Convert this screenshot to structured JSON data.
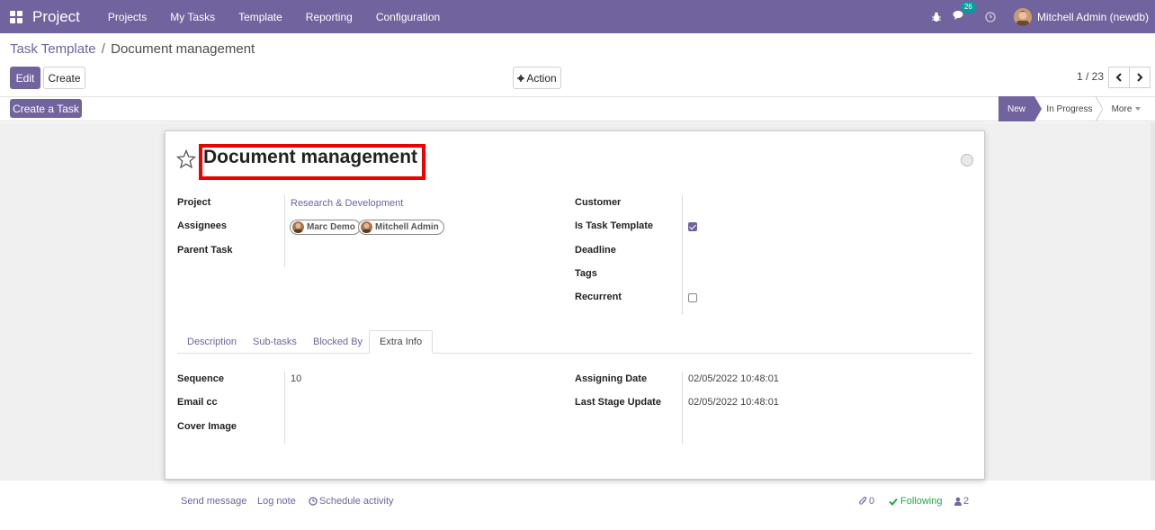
{
  "navbar": {
    "brand": "Project",
    "menu": [
      "Projects",
      "My Tasks",
      "Template",
      "Reporting",
      "Configuration"
    ],
    "chat_count": "26",
    "user_name": "Mitchell Admin (newdb)"
  },
  "breadcrumb": {
    "parent": "Task Template",
    "separator": "/",
    "current": "Document management"
  },
  "buttons": {
    "edit": "Edit",
    "create": "Create",
    "action": "Action",
    "create_task": "Create a Task"
  },
  "pager": {
    "value": "1 / 23"
  },
  "stages": {
    "new": "New",
    "in_progress": "In Progress",
    "more": "More"
  },
  "form": {
    "title": "Document management",
    "left": {
      "project_label": "Project",
      "project_value": "Research & Development",
      "assignees_label": "Assignees",
      "assignees": [
        "Marc Demo",
        "Mitchell Admin"
      ],
      "parent_task_label": "Parent Task"
    },
    "right": {
      "customer_label": "Customer",
      "is_template_label": "Is Task Template",
      "is_template": true,
      "deadline_label": "Deadline",
      "tags_label": "Tags",
      "recurrent_label": "Recurrent",
      "recurrent": false
    },
    "tabs": [
      "Description",
      "Sub-tasks",
      "Blocked By",
      "Extra Info"
    ],
    "active_tab": "Extra Info",
    "extra": {
      "sequence_label": "Sequence",
      "sequence_value": "10",
      "email_cc_label": "Email cc",
      "cover_image_label": "Cover Image",
      "assigning_date_label": "Assigning Date",
      "assigning_date_value": "02/05/2022 10:48:01",
      "last_stage_label": "Last Stage Update",
      "last_stage_value": "02/05/2022 10:48:01"
    }
  },
  "chatter": {
    "send_message": "Send message",
    "log_note": "Log note",
    "schedule_activity": "Schedule activity",
    "attachments": "0",
    "following": "Following",
    "followers": "2"
  },
  "colors": {
    "brand": "#71639e",
    "highlight": "#ee0000",
    "following": "#28a745"
  }
}
